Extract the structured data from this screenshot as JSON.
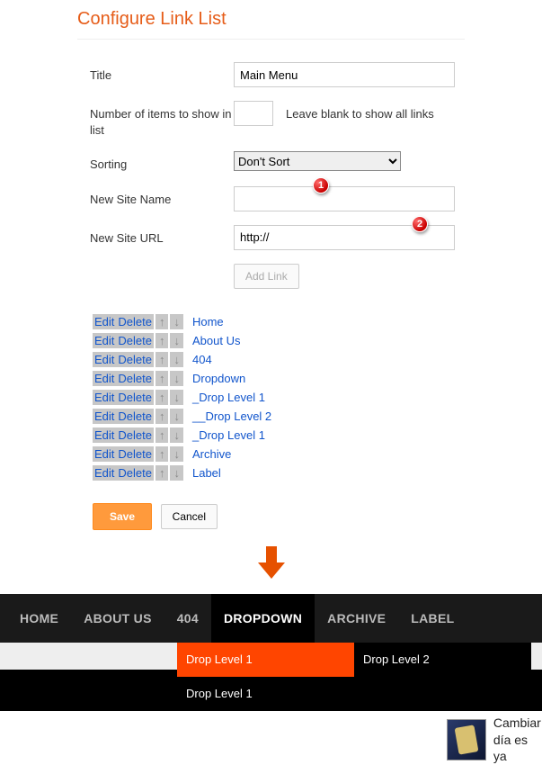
{
  "header": {
    "title": "Configure Link List"
  },
  "form": {
    "title_label": "Title",
    "title_value": "Main Menu",
    "num_label": "Number of items to show in list",
    "num_value": "",
    "num_hint": "Leave blank to show all links",
    "sorting_label": "Sorting",
    "sorting_value": "Don't Sort",
    "new_name_label": "New Site Name",
    "new_name_value": "",
    "new_url_label": "New Site URL",
    "new_url_value": "http://",
    "add_link_label": "Add Link"
  },
  "callouts": {
    "c1": "1",
    "c2": "2"
  },
  "list_actions": {
    "edit": "Edit",
    "delete": "Delete",
    "up": "↑",
    "down": "↓"
  },
  "links": [
    {
      "name": "Home"
    },
    {
      "name": "About Us"
    },
    {
      "name": "404"
    },
    {
      "name": "Dropdown"
    },
    {
      "name": "_Drop Level 1"
    },
    {
      "name": "__Drop Level 2"
    },
    {
      "name": "_Drop Level 1"
    },
    {
      "name": "Archive"
    },
    {
      "name": "Label"
    }
  ],
  "footer_buttons": {
    "save": "Save",
    "cancel": "Cancel"
  },
  "nav": {
    "items": [
      {
        "label": "HOME",
        "active": false
      },
      {
        "label": "ABOUT US",
        "active": false
      },
      {
        "label": "404",
        "active": false
      },
      {
        "label": "DROPDOWN",
        "active": true
      },
      {
        "label": "ARCHIVE",
        "active": false
      },
      {
        "label": "LABEL",
        "active": false
      }
    ],
    "dropdown": {
      "col1": [
        {
          "label": "Drop Level 1",
          "bg": "orange"
        },
        {
          "label": "Drop Level 1",
          "bg": "black"
        }
      ],
      "col2": [
        {
          "label": "Drop Level 2",
          "bg": "black"
        }
      ]
    }
  },
  "preview_article": {
    "line1": "Cambiar",
    "line2": "día es ya"
  }
}
